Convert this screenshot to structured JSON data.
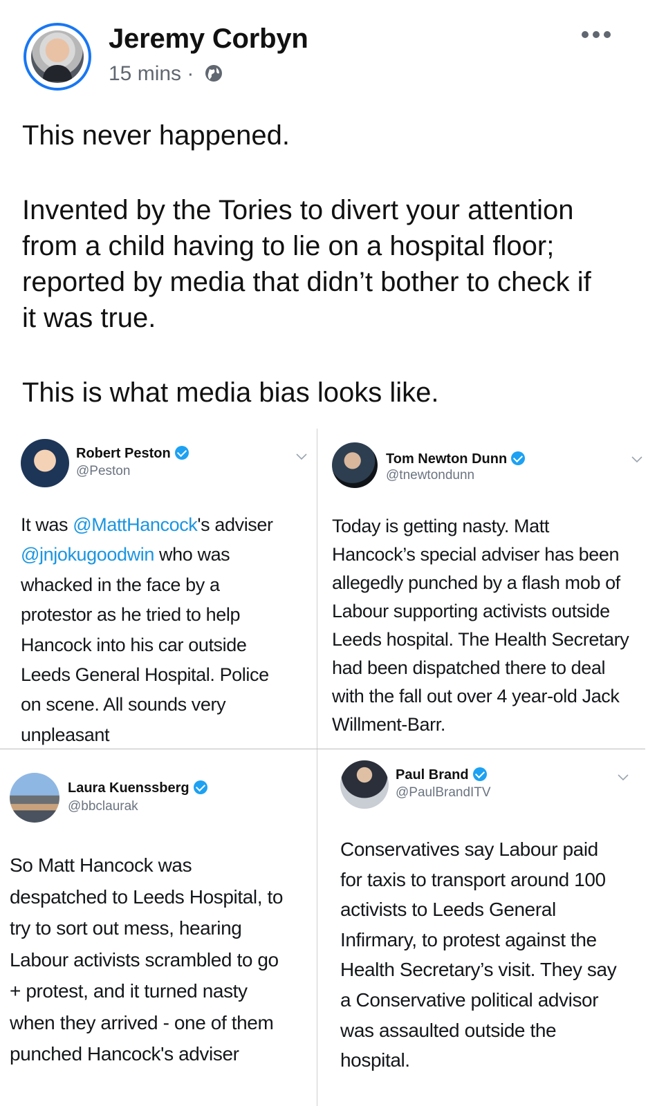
{
  "post": {
    "author": "Jeremy Corbyn",
    "time": "15 mins",
    "separator": "·",
    "privacy_icon": "globe-icon",
    "menu_icon": "more-icon",
    "paragraphs": [
      [
        "This never happened."
      ],
      [
        "Invented by the Tories to divert your attention",
        "from a child having to lie on a hospital floor;",
        "reported by media that didn’t bother to check if",
        "it was true."
      ],
      [
        "This is what media bias looks like."
      ]
    ]
  },
  "tweets": [
    {
      "name": "Robert Peston",
      "handle": "@Peston",
      "lines": [
        [
          {
            "t": "It was "
          },
          {
            "t": "@MattHancock",
            "m": true
          },
          {
            "t": "'s adviser"
          }
        ],
        [
          {
            "t": "@jnjokugoodwin",
            "m": true
          },
          {
            "t": " who was"
          }
        ],
        [
          {
            "t": "whacked in the face by a"
          }
        ],
        [
          {
            "t": "protestor as he tried to help"
          }
        ],
        [
          {
            "t": "Hancock into his car outside"
          }
        ],
        [
          {
            "t": "Leeds General Hospital. Police"
          }
        ],
        [
          {
            "t": "on scene. All sounds very"
          }
        ],
        [
          {
            "t": "unpleasant"
          }
        ]
      ]
    },
    {
      "name": "Tom Newton Dunn",
      "handle": "@tnewtondunn",
      "lines": [
        [
          {
            "t": "Today is getting nasty. Matt"
          }
        ],
        [
          {
            "t": "Hancock’s special adviser has been"
          }
        ],
        [
          {
            "t": "allegedly punched by a flash mob of"
          }
        ],
        [
          {
            "t": "Labour supporting activists outside"
          }
        ],
        [
          {
            "t": "Leeds hospital. The Health Secretary"
          }
        ],
        [
          {
            "t": "had been dispatched there to deal"
          }
        ],
        [
          {
            "t": "with the fall out over 4 year-old Jack"
          }
        ],
        [
          {
            "t": "Willment-Barr."
          }
        ]
      ]
    },
    {
      "name": "Laura Kuenssberg",
      "handle": "@bbclaurak",
      "lines": [
        [
          {
            "t": "So Matt Hancock was"
          }
        ],
        [
          {
            "t": "despatched to Leeds Hospital, to"
          }
        ],
        [
          {
            "t": "try to sort out mess, hearing"
          }
        ],
        [
          {
            "t": "Labour activists scrambled to go"
          }
        ],
        [
          {
            "t": "+ protest, and it turned nasty"
          }
        ],
        [
          {
            "t": "when they arrived - one of them"
          }
        ],
        [
          {
            "t": "punched Hancock's adviser"
          }
        ]
      ]
    },
    {
      "name": "Paul Brand",
      "handle": "@PaulBrandITV",
      "lines": [
        [
          {
            "t": "Conservatives say Labour paid"
          }
        ],
        [
          {
            "t": "for taxis to transport around 100"
          }
        ],
        [
          {
            "t": "activists to Leeds General"
          }
        ],
        [
          {
            "t": "Infirmary, to protest against the"
          }
        ],
        [
          {
            "t": "Health Secretary’s visit. They say"
          }
        ],
        [
          {
            "t": "a Conservative political advisor"
          }
        ],
        [
          {
            "t": "was assaulted outside the"
          }
        ],
        [
          {
            "t": "hospital."
          }
        ]
      ]
    }
  ]
}
